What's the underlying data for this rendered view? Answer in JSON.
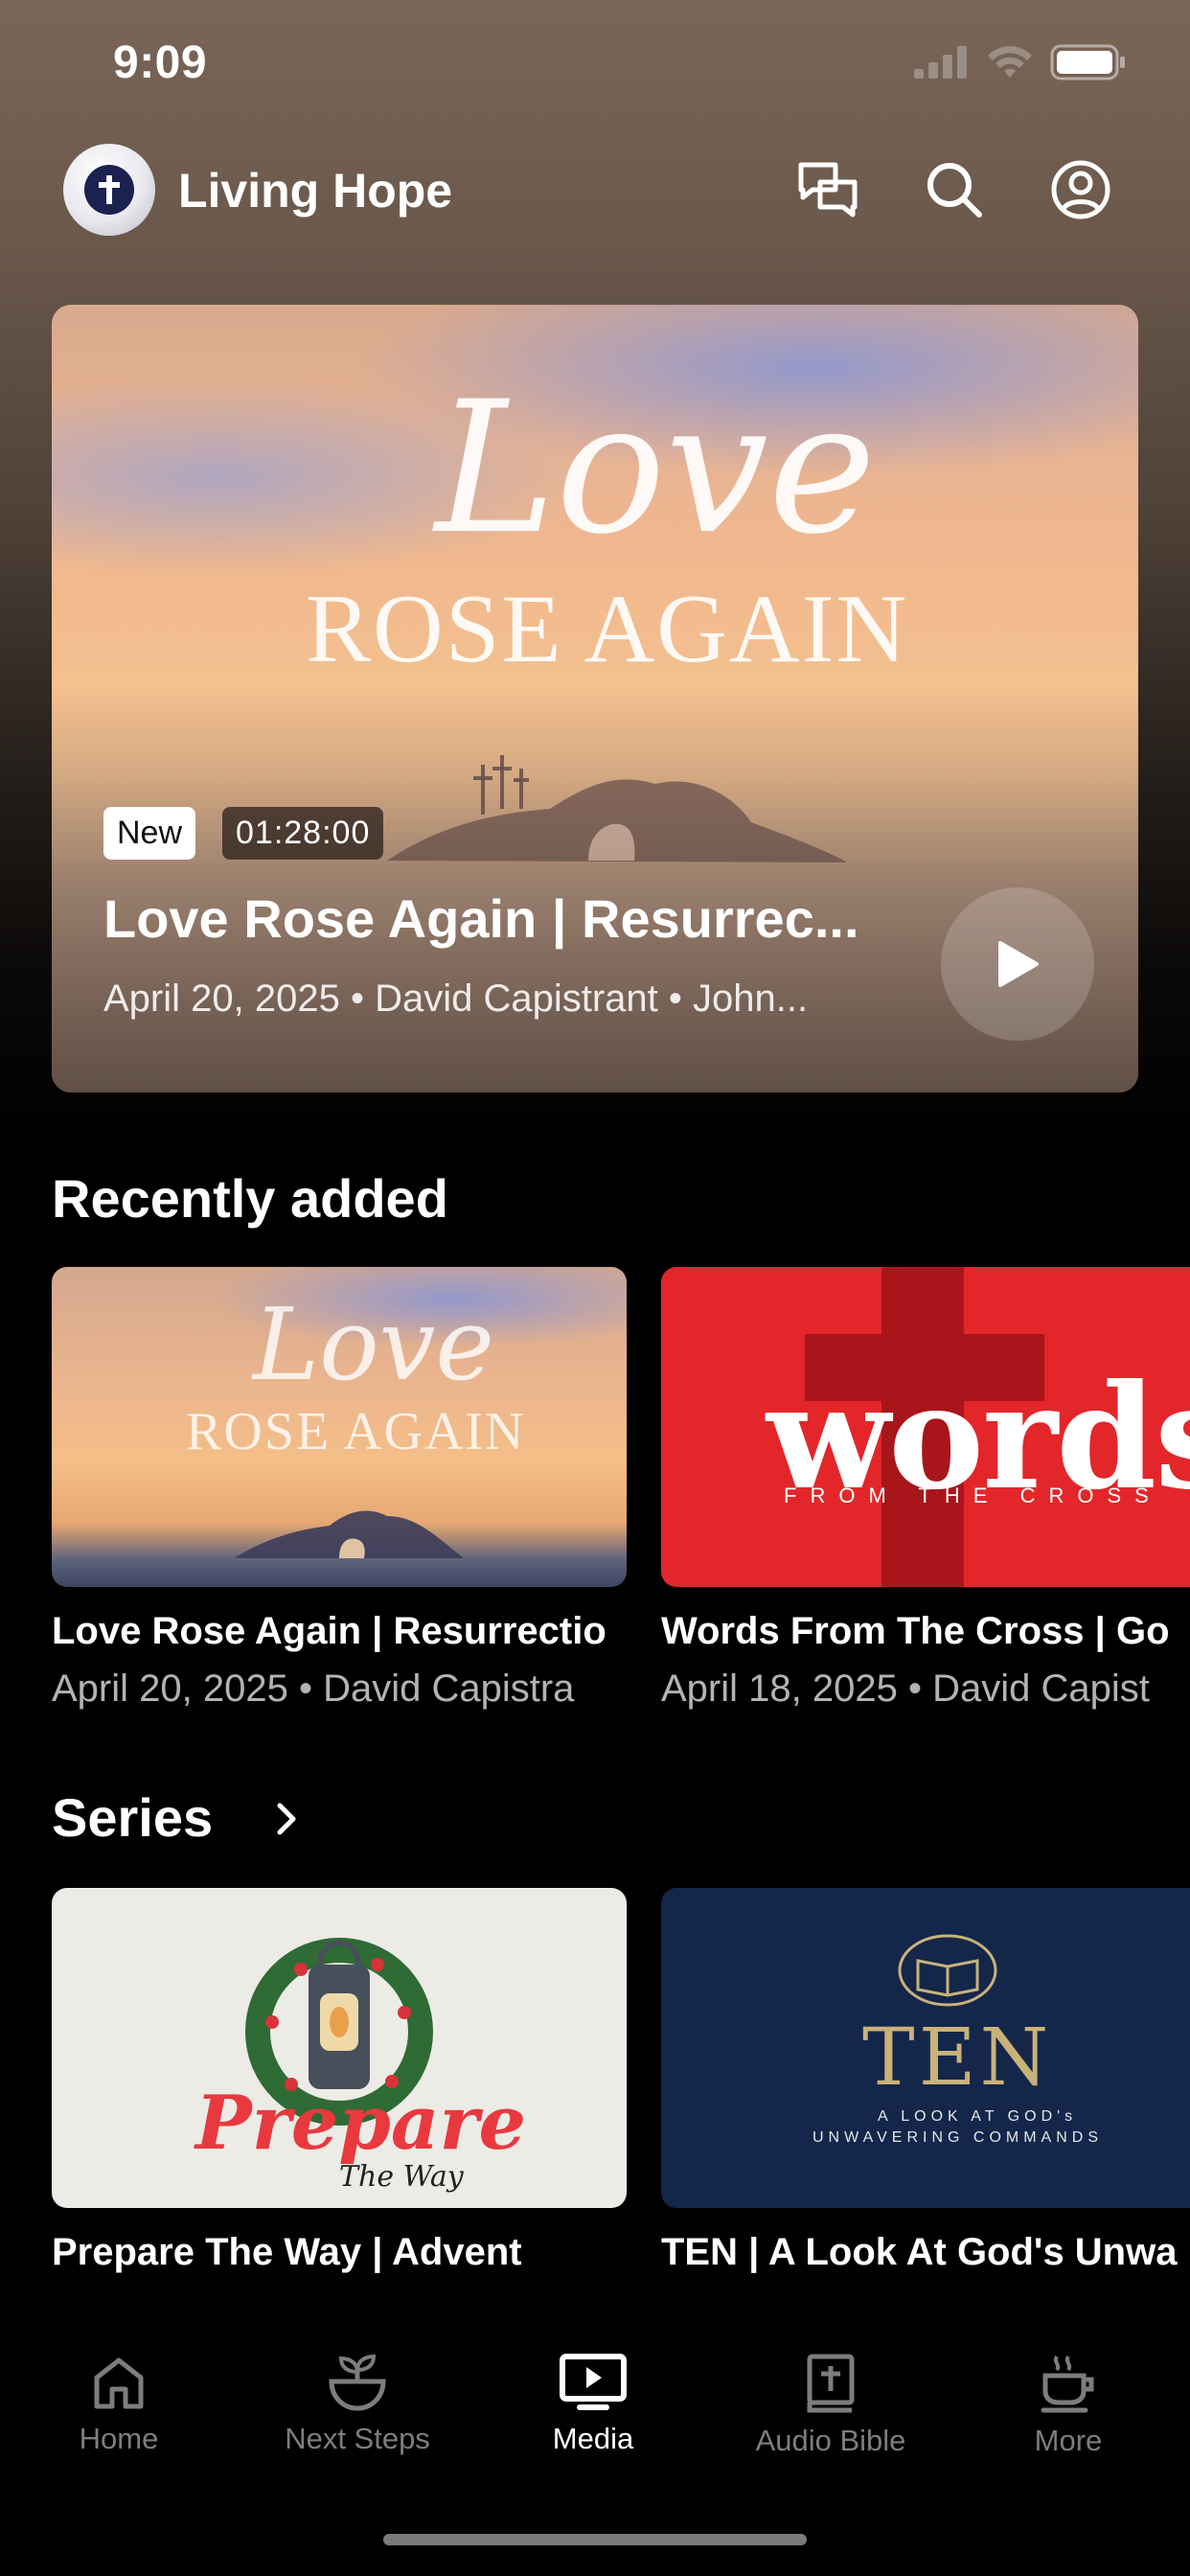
{
  "status_bar": {
    "time": "9:09"
  },
  "header": {
    "title": "Living Hope"
  },
  "hero": {
    "badge_new": "New",
    "duration": "01:28:00",
    "title": "Love Rose Again | Resurrec...",
    "meta": "April 20, 2025 • David Capistrant • John...",
    "artwork_script": "Love",
    "artwork_caps": "ROSE AGAIN"
  },
  "recently_added": {
    "heading": "Recently added",
    "items": [
      {
        "title": "Love Rose Again | Resurrectio",
        "meta": "April 20, 2025 • David Capistra",
        "artwork_script": "Love",
        "artwork_caps": "ROSE AGAIN"
      },
      {
        "title": "Words From The Cross | Go",
        "meta": "April 18, 2025 • David Capist",
        "artwork_title": "words",
        "artwork_sub": "FROM THE CROSS"
      }
    ]
  },
  "series": {
    "heading": "Series",
    "items": [
      {
        "title": "Prepare The Way | Advent",
        "artwork_title": "Prepare",
        "artwork_sub": "The Way"
      },
      {
        "title": "TEN | A Look At God's Unwa",
        "artwork_title": "TEN",
        "artwork_sub1": "A LOOK AT GOD's",
        "artwork_sub2": "UNWAVERING COMMANDS"
      }
    ]
  },
  "tabs": [
    {
      "label": "Home",
      "icon": "home-icon",
      "active": false
    },
    {
      "label": "Next Steps",
      "icon": "sprout-icon",
      "active": false
    },
    {
      "label": "Media",
      "icon": "media-icon",
      "active": true
    },
    {
      "label": "Audio Bible",
      "icon": "bible-icon",
      "active": false
    },
    {
      "label": "More",
      "icon": "coffee-cup-icon",
      "active": false
    }
  ],
  "colors": {
    "words_red": "#e3262a",
    "ten_navy": "#14264a",
    "ten_gold": "#c9b27a",
    "prepare_red": "#e8393e",
    "active_tab": "#ffffff",
    "inactive_tab": "#7d7d7d"
  }
}
